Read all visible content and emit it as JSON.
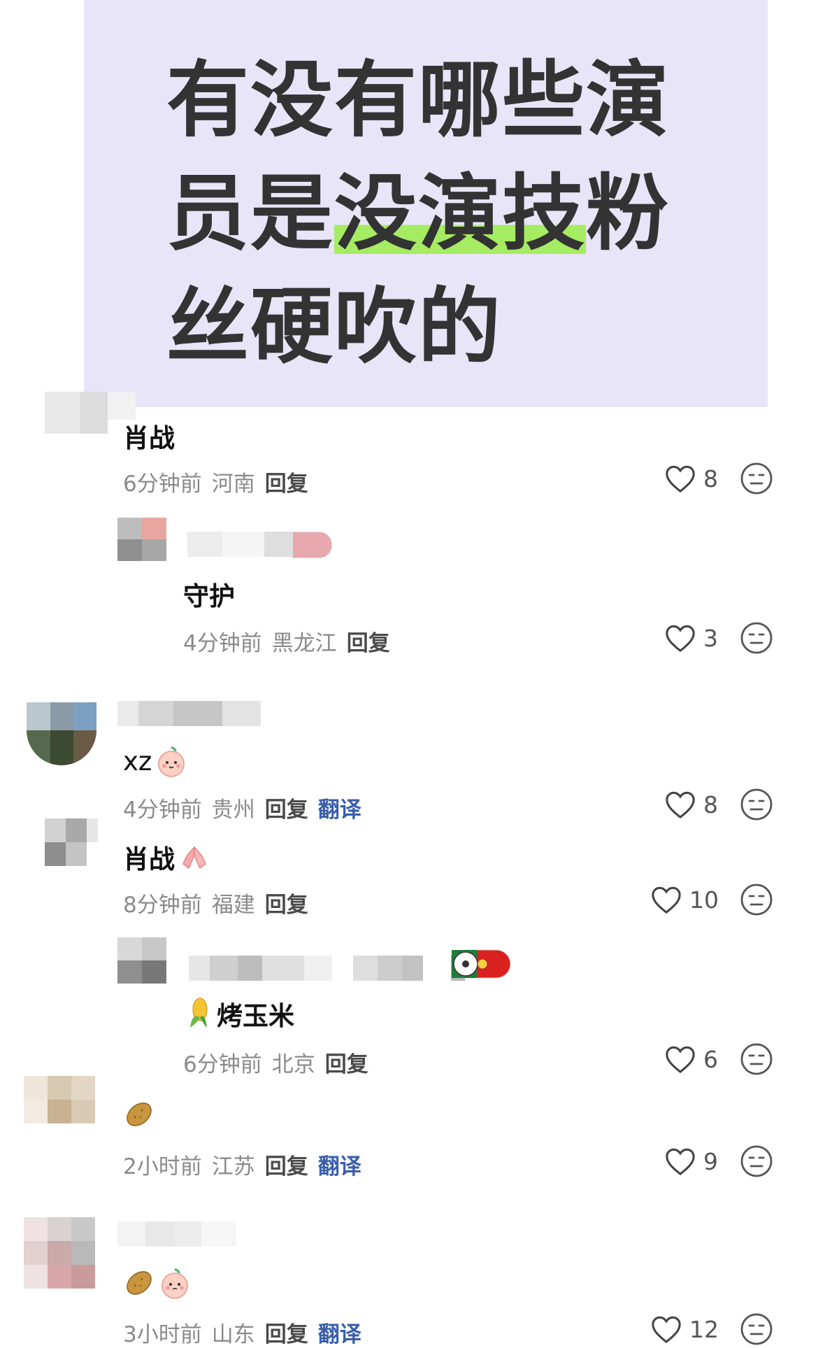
{
  "banner": {
    "title_part1": "有没有哪些演员是",
    "title_highlight": "没演技",
    "title_part2": "粉丝硬吹的"
  },
  "comments": [
    {
      "text": "肖战",
      "time": "6分钟前",
      "location": "河南",
      "reply": "回复",
      "likes": "8"
    },
    {
      "text": "守护",
      "time": "4分钟前",
      "location": "黑龙江",
      "reply": "回复",
      "likes": "3"
    },
    {
      "text": "xz",
      "time": "4分钟前",
      "location": "贵州",
      "reply": "回复",
      "translate": "翻译",
      "likes": "8"
    },
    {
      "text": "肖战",
      "time": "8分钟前",
      "location": "福建",
      "reply": "回复",
      "likes": "10"
    },
    {
      "text": "烤玉米",
      "time": "6分钟前",
      "location": "北京",
      "reply": "回复",
      "likes": "6"
    },
    {
      "text": "",
      "time": "2小时前",
      "location": "江苏",
      "reply": "回复",
      "translate": "翻译",
      "likes": "9"
    },
    {
      "text": "",
      "time": "3小时前",
      "location": "山东",
      "reply": "回复",
      "translate": "翻译",
      "likes": "12"
    }
  ],
  "colors": {
    "banner_bg": "#e8e5f8",
    "highlight": "#a6ec63",
    "translate_link": "#3a5fa8"
  },
  "icons": [
    "heart-outline-icon",
    "meh-face-icon"
  ]
}
